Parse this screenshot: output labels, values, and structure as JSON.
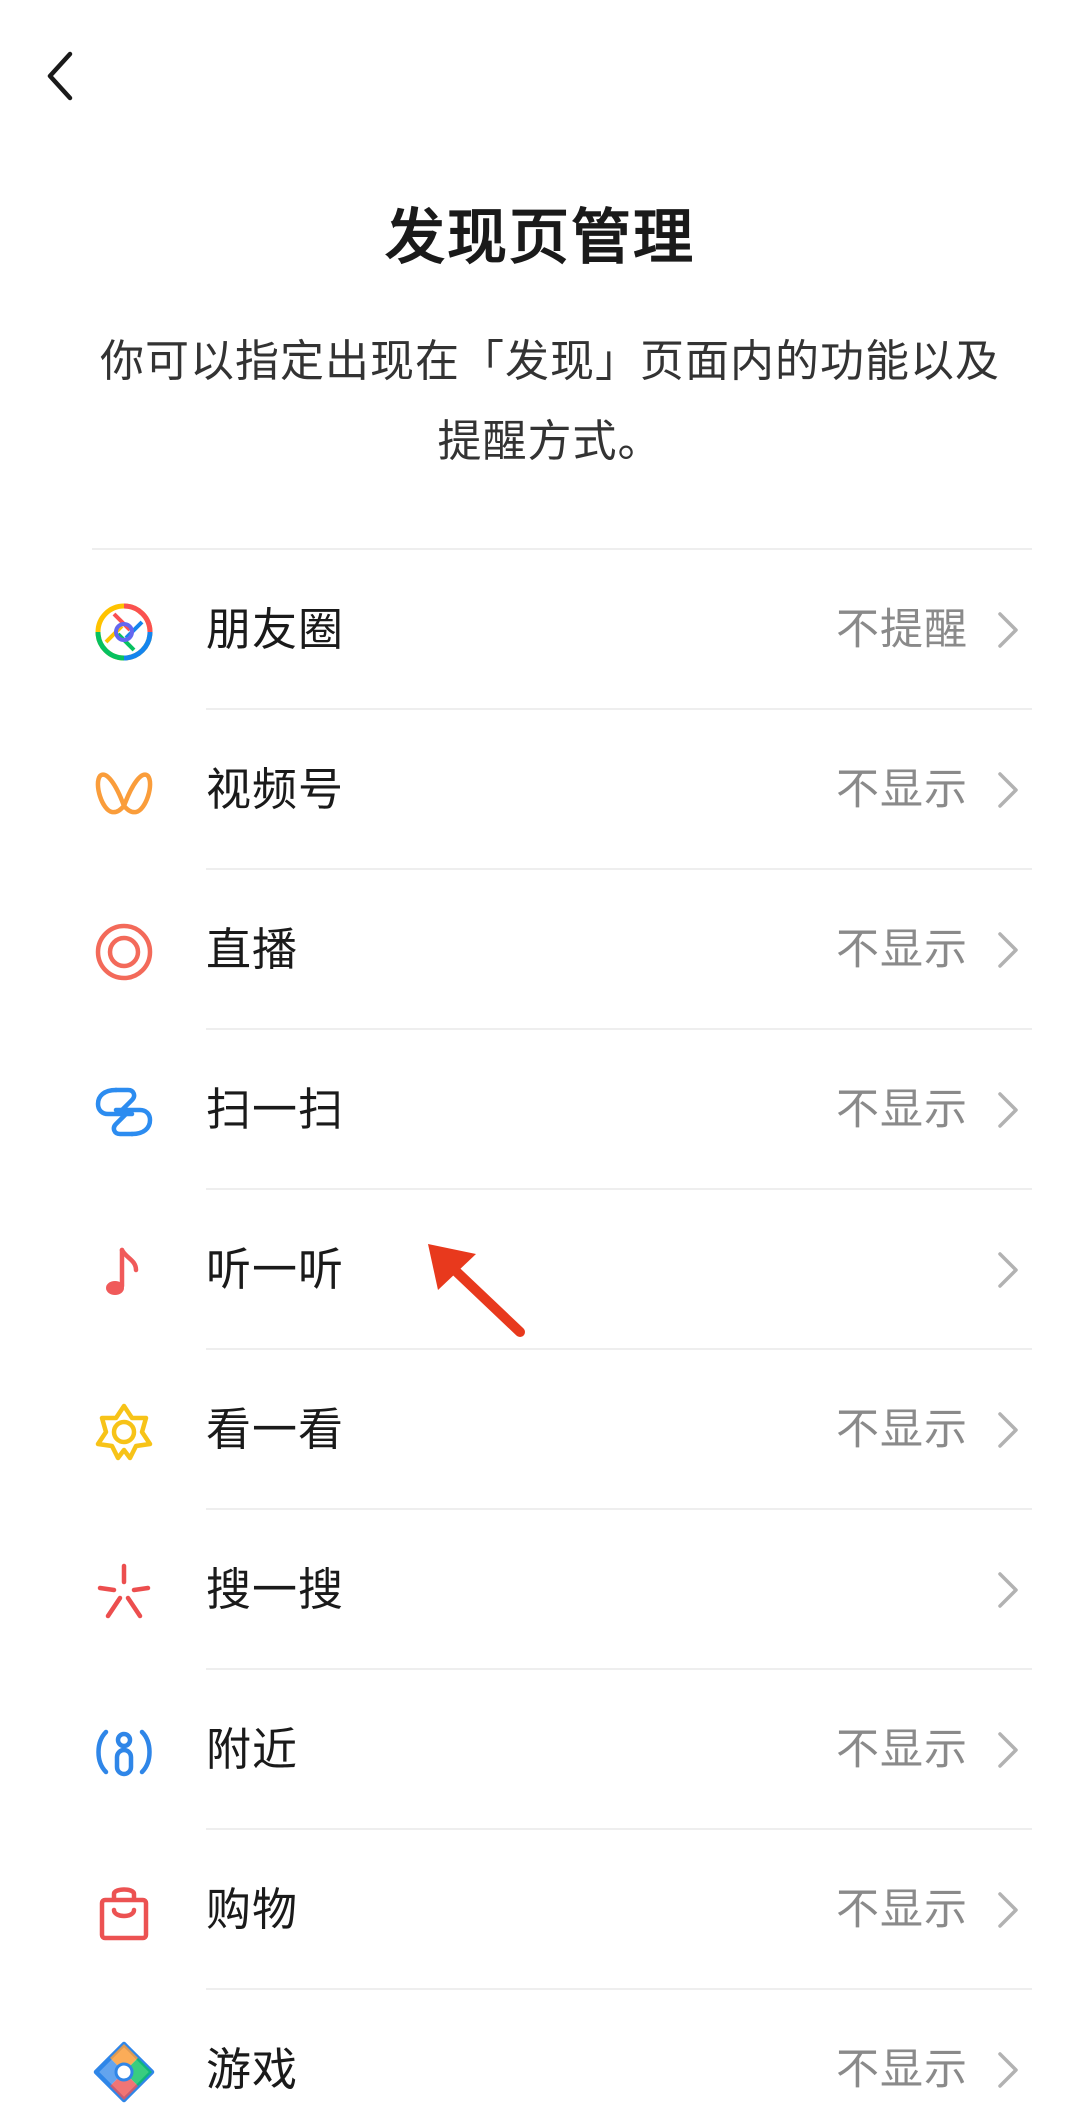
{
  "header": {
    "back_icon": "chevron-left-icon",
    "title": "发现页管理",
    "description": "你可以指定出现在「发现」页面内的功能以及提醒方式。"
  },
  "colors": {
    "annotation_arrow": "#e8391d",
    "status_text": "#8a8a8a",
    "divider": "#eeeeee"
  },
  "items": [
    {
      "label": "朋友圈",
      "status": "不提醒",
      "icon": "moments-icon"
    },
    {
      "label": "视频号",
      "status": "不显示",
      "icon": "channels-icon"
    },
    {
      "label": "直播",
      "status": "不显示",
      "icon": "live-icon"
    },
    {
      "label": "扫一扫",
      "status": "不显示",
      "icon": "scan-icon"
    },
    {
      "label": "听一听",
      "status": "",
      "icon": "music-note-icon"
    },
    {
      "label": "看一看",
      "status": "不显示",
      "icon": "top-stories-icon"
    },
    {
      "label": "搜一搜",
      "status": "",
      "icon": "search-sparkle-icon"
    },
    {
      "label": "附近",
      "status": "不显示",
      "icon": "nearby-icon"
    },
    {
      "label": "购物",
      "status": "不显示",
      "icon": "shopping-bag-icon"
    },
    {
      "label": "游戏",
      "status": "不显示",
      "icon": "games-icon"
    }
  ]
}
